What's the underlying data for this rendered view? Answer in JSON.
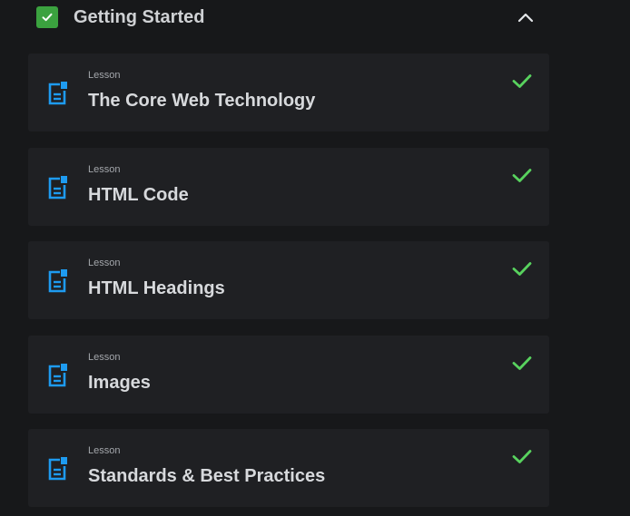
{
  "section": {
    "title": "Getting Started",
    "completed": true,
    "expanded": true
  },
  "lessons": [
    {
      "kind": "Lesson",
      "title": "The Core Web Technology",
      "completed": true
    },
    {
      "kind": "Lesson",
      "title": "HTML Code",
      "completed": true
    },
    {
      "kind": "Lesson",
      "title": "HTML Headings",
      "completed": true
    },
    {
      "kind": "Lesson",
      "title": "Images",
      "completed": true
    },
    {
      "kind": "Lesson",
      "title": "Standards & Best Practices",
      "completed": true
    }
  ],
  "colors": {
    "background": "#17181a",
    "card": "#1f2023",
    "accent_blue": "#1e9bf0",
    "check_green": "#58d25e",
    "section_check_bg": "#3ba23f"
  },
  "icons": {
    "section_check": "checkbox-checked-icon",
    "collapse": "chevron-up-icon",
    "lesson": "document-icon",
    "done": "checkmark-icon"
  }
}
